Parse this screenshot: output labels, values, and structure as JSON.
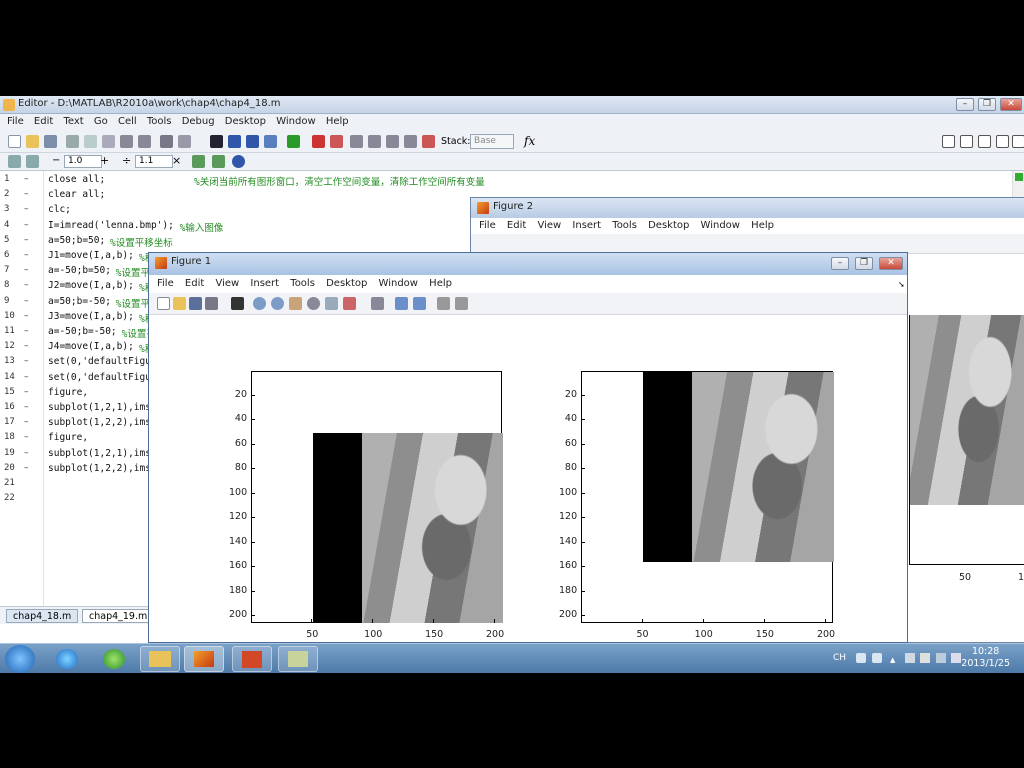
{
  "editor": {
    "title": "Editor - D:\\MATLAB\\R2010a\\work\\chap4\\chap4_18.m",
    "menu": [
      "File",
      "Edit",
      "Text",
      "Go",
      "Cell",
      "Tools",
      "Debug",
      "Desktop",
      "Window",
      "Help"
    ],
    "toolbar": {
      "stack_label": "Stack:",
      "stack_value": "Base",
      "fx_label": "fx"
    },
    "cell_toolbar": {
      "minus": "−",
      "step1": "1.0",
      "plus": "+",
      "divide": "÷",
      "step2": "1.1",
      "times": "×"
    },
    "lines": [
      {
        "n": "1",
        "dash": "–",
        "code": "close all;",
        "comment": "%关闭当前所有图形窗口，清空工作空间变量，清除工作空间所有变量"
      },
      {
        "n": "2",
        "dash": "–",
        "code": "clear all;",
        "comment": ""
      },
      {
        "n": "3",
        "dash": "–",
        "code": "clc;",
        "comment": ""
      },
      {
        "n": "4",
        "dash": "–",
        "code": "I=imread('lenna.bmp');",
        "comment": "%输入图像"
      },
      {
        "n": "5",
        "dash": "–",
        "code": "a=50;b=50;",
        "comment": "%设置平移坐标"
      },
      {
        "n": "6",
        "dash": "–",
        "code": "J1=move(I,a,b);",
        "comment": "%移动原图像"
      },
      {
        "n": "7",
        "dash": "–",
        "code": "a=-50;b=50;",
        "comment": "%设置平移"
      },
      {
        "n": "8",
        "dash": "–",
        "code": "J2=move(I,a,b);",
        "comment": "%移动"
      },
      {
        "n": "9",
        "dash": "–",
        "code": "a=50;b=-50;",
        "comment": "%设置平移"
      },
      {
        "n": "10",
        "dash": "–",
        "code": "J3=move(I,a,b);",
        "comment": "%移动"
      },
      {
        "n": "11",
        "dash": "–",
        "code": "a=-50;b=-50;",
        "comment": "%设置平"
      },
      {
        "n": "12",
        "dash": "–",
        "code": "J4=move(I,a,b);",
        "comment": "%移动"
      },
      {
        "n": "13",
        "dash": "–",
        "code": "set(0,'defaultFigur",
        "comment": ""
      },
      {
        "n": "14",
        "dash": "–",
        "code": "set(0,'defaultFigur",
        "comment": ""
      },
      {
        "n": "15",
        "dash": "–",
        "code": "figure,",
        "comment": ""
      },
      {
        "n": "16",
        "dash": "–",
        "code": "subplot(1,2,1),imsh",
        "comment": ""
      },
      {
        "n": "17",
        "dash": "–",
        "code": "subplot(1,2,2),imsh",
        "comment": ""
      },
      {
        "n": "18",
        "dash": "–",
        "code": "figure,",
        "comment": ""
      },
      {
        "n": "19",
        "dash": "–",
        "code": "subplot(1,2,1),imsh",
        "comment": ""
      },
      {
        "n": "20",
        "dash": "–",
        "code": "subplot(1,2,2),imsh",
        "comment": ""
      },
      {
        "n": "21",
        "dash": "",
        "code": "",
        "comment": ""
      },
      {
        "n": "22",
        "dash": "",
        "code": "",
        "comment": ""
      }
    ],
    "tabs": [
      "chap4_18.m",
      "chap4_19.m"
    ]
  },
  "figure2": {
    "title": "Figure 2",
    "menu": [
      "File",
      "Edit",
      "View",
      "Insert",
      "Tools",
      "Desktop",
      "Window",
      "Help"
    ],
    "xticks": [
      "50",
      "1"
    ]
  },
  "figure1": {
    "title": "Figure 1",
    "menu": [
      "File",
      "Edit",
      "View",
      "Insert",
      "Tools",
      "Desktop",
      "Window",
      "Help"
    ],
    "axes_left": {
      "yticks": [
        "20",
        "40",
        "60",
        "80",
        "100",
        "120",
        "140",
        "160",
        "180",
        "200"
      ],
      "xticks": [
        "50",
        "100",
        "150",
        "200"
      ]
    },
    "axes_right": {
      "yticks": [
        "20",
        "40",
        "60",
        "80",
        "100",
        "120",
        "140",
        "160",
        "180",
        "200"
      ],
      "xticks": [
        "50",
        "100",
        "150",
        "200"
      ]
    }
  },
  "taskbar": {
    "apps": [
      "start",
      "internet-explorer",
      "360-browser",
      "file-explorer",
      "matlab",
      "powerpoint",
      "notepad"
    ],
    "lang": "CH",
    "time": "10:28",
    "date": "2013/1/25"
  }
}
